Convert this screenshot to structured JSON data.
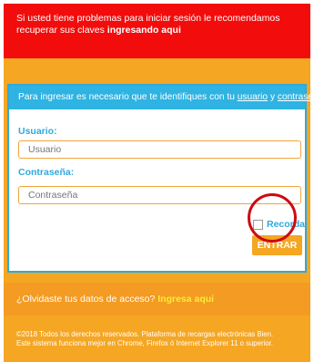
{
  "alert": {
    "text": "Si usted tiene problemas para iniciar sesión le recomendamos recuperar sus claves ",
    "link": "ingresando aqui"
  },
  "panel": {
    "intro": "Para ingresar es necesario que te identifiques con tu ",
    "link_usuario": "usuario",
    "and": " y ",
    "link_password": "contraseña"
  },
  "form": {
    "user_label": "Usuario:",
    "user_placeholder": "Usuario",
    "password_label": "Contraseña:",
    "password_placeholder": "Contraseña",
    "remember_label": "Recorda",
    "enter_button": "ENTRAR"
  },
  "forgot": {
    "text": "¿Olvidaste tus datos de acceso? ",
    "link": "Ingresa aqui"
  },
  "footer": {
    "line1": "©2018 Todos los derechos reservados. Plataforma de recargas electrónicas Bien.",
    "line2": "Este sistema funciona mejor en Chrome, Firefox ó Internet Explorer 11 o superior."
  },
  "colors": {
    "background": "#f5a623",
    "alert": "#f20c0c",
    "accent": "#2fb3e3",
    "highlight_circle": "#cc0a12"
  }
}
